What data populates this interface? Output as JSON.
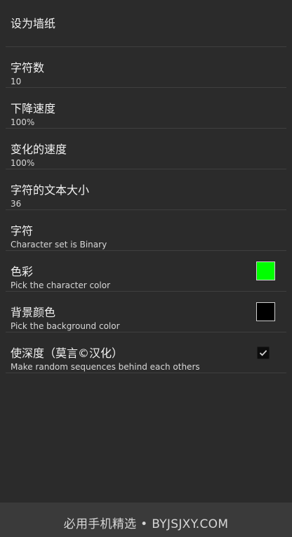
{
  "settings": {
    "set_wallpaper": "设为墙纸",
    "char_count": {
      "title": "字符数",
      "value": "10"
    },
    "fall_speed": {
      "title": "下降速度",
      "value": "100%"
    },
    "change_speed": {
      "title": "变化的速度",
      "value": "100%"
    },
    "text_size": {
      "title": "字符的文本大小",
      "value": "36"
    },
    "charset": {
      "title": "字符",
      "summary": "Character set is Binary"
    },
    "color": {
      "title": "色彩",
      "summary": "Pick the character color",
      "swatch": "#00ff00"
    },
    "background": {
      "title": "背景颜色",
      "summary": "Pick the background color",
      "swatch": "#000000"
    },
    "depth": {
      "title": "使深度（莫言©汉化）",
      "summary": "Make random sequences behind each others",
      "checked": true
    }
  },
  "footer": {
    "text": "必用手机精选 • BYJSJXY.COM"
  }
}
